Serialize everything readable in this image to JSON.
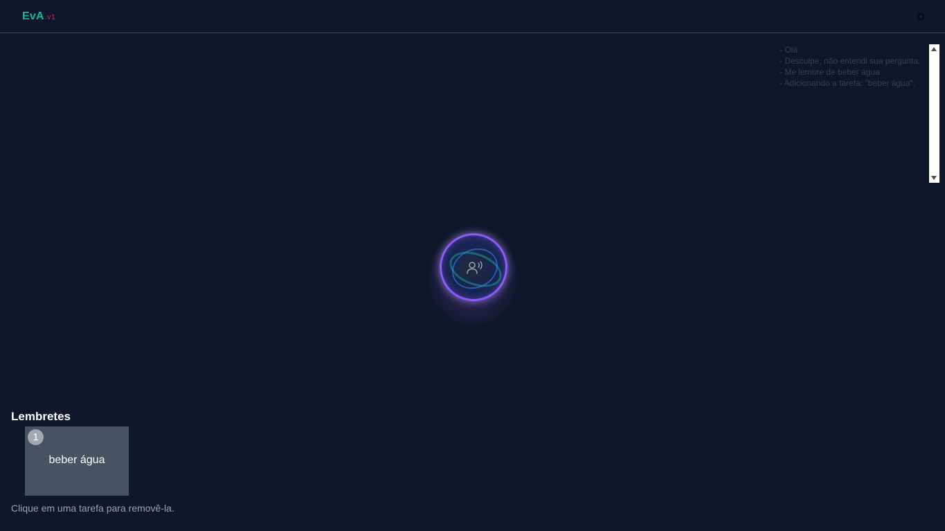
{
  "header": {
    "logo": "EvA",
    "version": ".v1"
  },
  "log": {
    "lines": [
      "- Olá",
      "- Desculpe, não entendi sua pergunta.",
      "- Me lembre de beber água",
      "- Adicionando a tarefa: \"beber água\"."
    ]
  },
  "assistant": {
    "icon": "voice-recognition-icon",
    "accent_color": "#8b5cf6",
    "ring_color": "#14b8a6"
  },
  "reminders": {
    "title": "Lembretes",
    "items": [
      {
        "number": "1",
        "text": "beber água"
      }
    ],
    "hint": "Clique em uma tarefa para removê-la."
  },
  "colors": {
    "background": "#0f172a",
    "logo": "#14b8a6",
    "version": "#e11d48",
    "card": "#475262"
  }
}
